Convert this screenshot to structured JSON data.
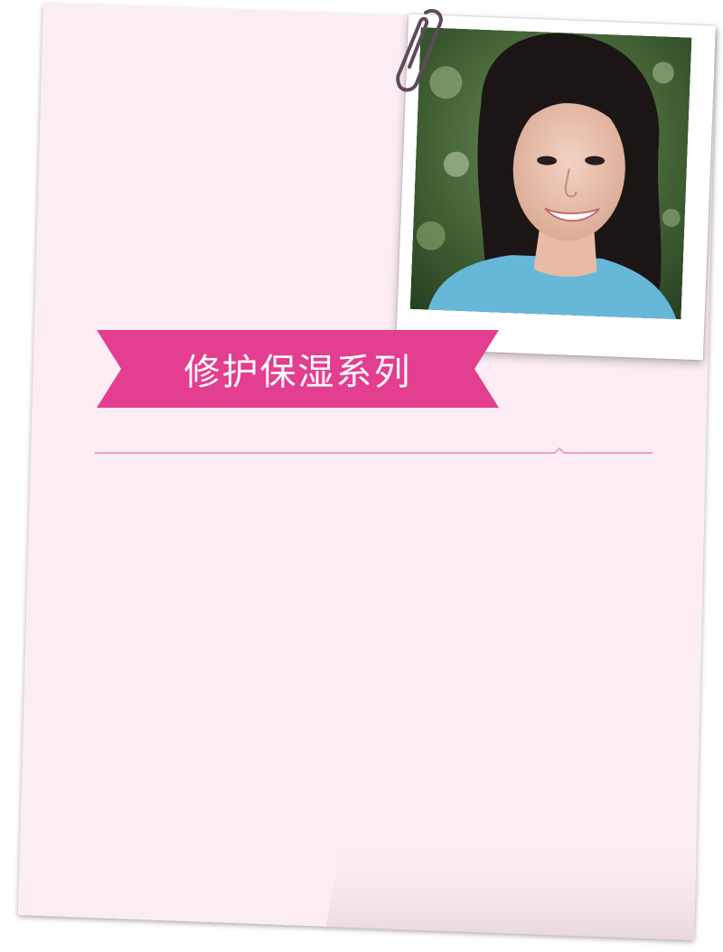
{
  "banner": {
    "title": "修护保湿系列"
  },
  "photo": {
    "icon": "portrait-photo"
  },
  "colors": {
    "sheet": "#fcedf4",
    "ribbon": "#e33e90",
    "divider": "#eaa0cd",
    "clip": "#5e4a5a"
  }
}
